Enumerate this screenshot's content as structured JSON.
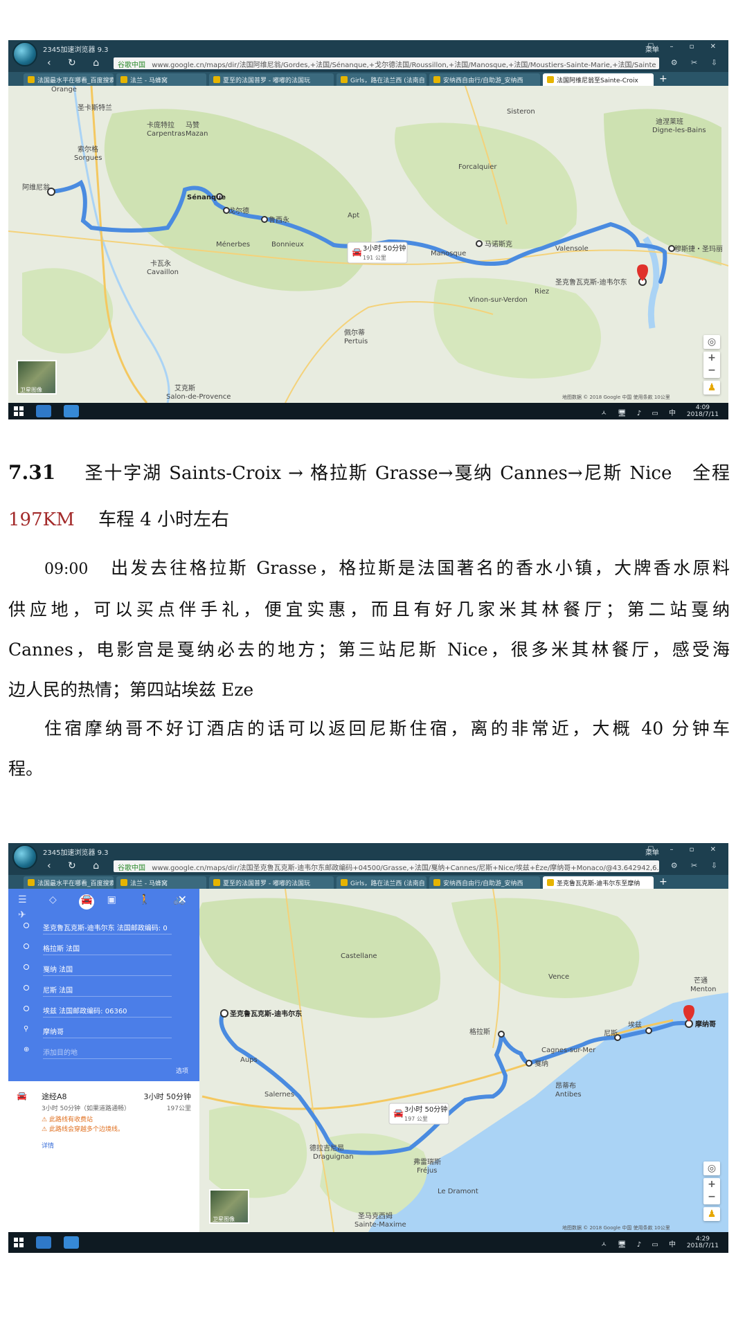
{
  "shot1": {
    "browser": {
      "app_title": "2345加速浏览器 9.3",
      "menu_label": "菜单",
      "url_secure": "谷歌中国",
      "url": "www.google.cn/maps/dir/法国阿维尼翁/Gordes,+法国/Sénanque,+戈尔德法国/Roussillon,+法国/Manosque,+法国/Moustiers-Sainte-Marie,+法国/Sainte",
      "tabs": [
        "法国最水平在哪看_百度搜索",
        "法兰 - 马蜂窝",
        "夏至的法国普罗 - 嘟嘟的法国玩",
        "Girls，路在法兰西 (法南自",
        "安纳西自由行/自助游_安纳西",
        "法国阿维尼翁至Sainte-Croix"
      ],
      "active_tab": 5
    },
    "map": {
      "places": [
        "Orange",
        "圣卡斯特兰",
        "卡庞特拉",
        "Carpentras",
        "马赞",
        "Mazan",
        "索尔格",
        "Sorgues",
        "阿维尼翁",
        "Sénanque",
        "戈尔德",
        "鲁西永",
        "马诺斯克",
        "穆斯捷・圣玛丽",
        "圣克鲁瓦克斯-迪韦尔东",
        "卡瓦永",
        "Cavaillon",
        "迪涅莱班",
        "Digne-les-Bains",
        "佩尔蒂",
        "Pertuis",
        "艾克斯",
        "Salon-de-Provence",
        "Vinon-sur-Verdon",
        "Riez",
        "Valensole",
        "Manosque",
        "Ménerbes",
        "Bonnieux",
        "Apt",
        "Forcalquier",
        "Sisteron"
      ],
      "route_time": "3小时 50分钟",
      "route_dist": "191 公里",
      "satellite_label": "卫星图像",
      "footer": "地图数据 © 2018 Google   中国   使用条款   10公里"
    },
    "taskbar": {
      "time": "4:09",
      "date": "2018/7/11",
      "tray": "ㅅ 🖥 ♪ ▭ 中"
    }
  },
  "text": {
    "date": "7.31",
    "line1": "圣十字湖 Saints-Croix → 格拉斯 Grasse→戛纳 Cannes→尼斯 Nice　全程",
    "distance": "197KM",
    "line1b": "　车程 4 小时左右",
    "time": "09:00",
    "para1_a": "出发去往格拉斯 Grasse，格拉斯是法国著名的香水小镇，大牌香水原料",
    "para1_b": "供应地，可以买点伴手礼，便宜实惠，而且有好几家米其林餐厅；第二站戛纳",
    "para1_c": "Cannes，电影宫是戛纳必去的地方；第三站尼斯 Nice，很多米其林餐厅，感受海",
    "para1_d": "边人民的热情；第四站埃兹 Eze",
    "para2_a": "住宿摩纳哥不好订酒店的话可以返回尼斯住宿，离的非常近，大概 40 分钟车",
    "para2_b": "程。"
  },
  "shot2": {
    "browser": {
      "app_title": "2345加速浏览器 9.3",
      "menu_label": "菜单",
      "url_secure": "谷歌中国",
      "url": "www.google.cn/maps/dir/法国圣克鲁瓦克斯-迪韦尔东邮政编码+04500/Grasse,+法国/戛纳+Cannes/尼斯+Nice/埃兹+Èze/摩纳哥+Monaco/@43.642942,6.6",
      "tabs": [
        "法国最水平在哪看_百度搜索",
        "法兰 - 马蜂窝",
        "夏至的法国普罗 - 嘟嘟的法国玩",
        "Girls，路在法兰西 (法南自",
        "安纳西自由行/自助游_安纳西",
        "圣克鲁瓦克斯-迪韦尔东至摩纳"
      ],
      "active_tab": 5
    },
    "panel": {
      "stops": [
        "圣克鲁瓦克斯-迪韦尔东 法国邮政编码: 0",
        "格拉斯 法国",
        "戛纳 法国",
        "尼斯 法国",
        "埃兹 法国邮政编码: 06360",
        "摩纳哥"
      ],
      "add_destination": "添加目的地",
      "options": "选项",
      "route_via": "途经A8",
      "route_duration": "3小时 50分钟",
      "route_detail": "3小时 50分钟（如果道路通畅）",
      "route_distance": "197公里",
      "warnings": [
        "此路线有收费站",
        "此路线会穿越多个边境线。"
      ],
      "details_link": "详情"
    },
    "map": {
      "places": [
        "圣克鲁瓦克斯-迪韦尔东",
        "格拉斯",
        "戛纳",
        "尼斯",
        "埃兹",
        "摩纳哥",
        "Menton",
        "芒通",
        "Antibes",
        "昂蒂布",
        "Cagnes-sur-Mer",
        "Fréjus",
        "弗雷瑞斯",
        "Draguignan",
        "德拉吉尼昂",
        "Sainte-Maxime",
        "圣马克西姆",
        "Castellane",
        "Vence",
        "Le Dramont",
        "Aups",
        "Salernes"
      ],
      "route_time": "3小时 50分钟",
      "route_dist": "197 公里",
      "satellite_label": "卫星图像",
      "footer": "地图数据 © 2018 Google   中国   使用条款   10公里"
    },
    "taskbar": {
      "time": "4:29",
      "date": "2018/7/11",
      "tray": "ㅅ 🖥 ♪ ▭ 中"
    }
  },
  "icons": {
    "back": "‹",
    "forward": "›",
    "reload": "↻",
    "home": "⌂",
    "star": "☆",
    "plus": "+",
    "minus": "−",
    "pin": "📍"
  },
  "colors": {
    "route": "#4a8be0",
    "map_green": "#cfe2b3",
    "map_land": "#ecefe5",
    "sea": "#aad3f5",
    "highlight_red": "#a32a2a"
  }
}
